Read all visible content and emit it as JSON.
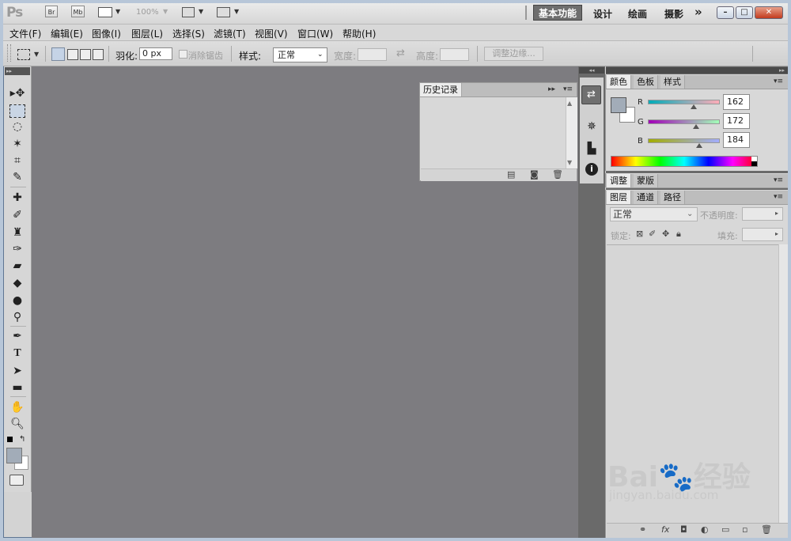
{
  "app": {
    "logo": "Ps",
    "bridge_btn": "Br",
    "minibridge_btn": "Mb",
    "zoom": "100%",
    "workspaces": [
      "基本功能",
      "设计",
      "绘画",
      "摄影"
    ],
    "more": "»"
  },
  "menu": [
    "文件(F)",
    "编辑(E)",
    "图像(I)",
    "图层(L)",
    "选择(S)",
    "滤镜(T)",
    "视图(V)",
    "窗口(W)",
    "帮助(H)"
  ],
  "options": {
    "feather_label": "羽化:",
    "feather_value": "0 px",
    "antialias_label": "消除锯齿",
    "style_label": "样式:",
    "style_value": "正常",
    "width_label": "宽度:",
    "height_label": "高度:",
    "refine_edge": "调整边缘..."
  },
  "history_panel": {
    "title": "历史记录"
  },
  "color_panel": {
    "tabs": [
      "颜色",
      "色板",
      "样式"
    ],
    "r_label": "R",
    "g_label": "G",
    "b_label": "B",
    "r": 162,
    "g": 172,
    "b": 184,
    "fg_color": "#a2acb8"
  },
  "adjust_panel": {
    "tabs": [
      "调整",
      "蒙版"
    ]
  },
  "layers_panel": {
    "tabs": [
      "图层",
      "通道",
      "路径"
    ],
    "blend_mode": "正常",
    "opacity_label": "不透明度:",
    "lock_label": "锁定:",
    "fill_label": "填充:"
  },
  "watermark": {
    "brand": "Bai🐾经验",
    "url": "jingyan.baidu.com"
  }
}
